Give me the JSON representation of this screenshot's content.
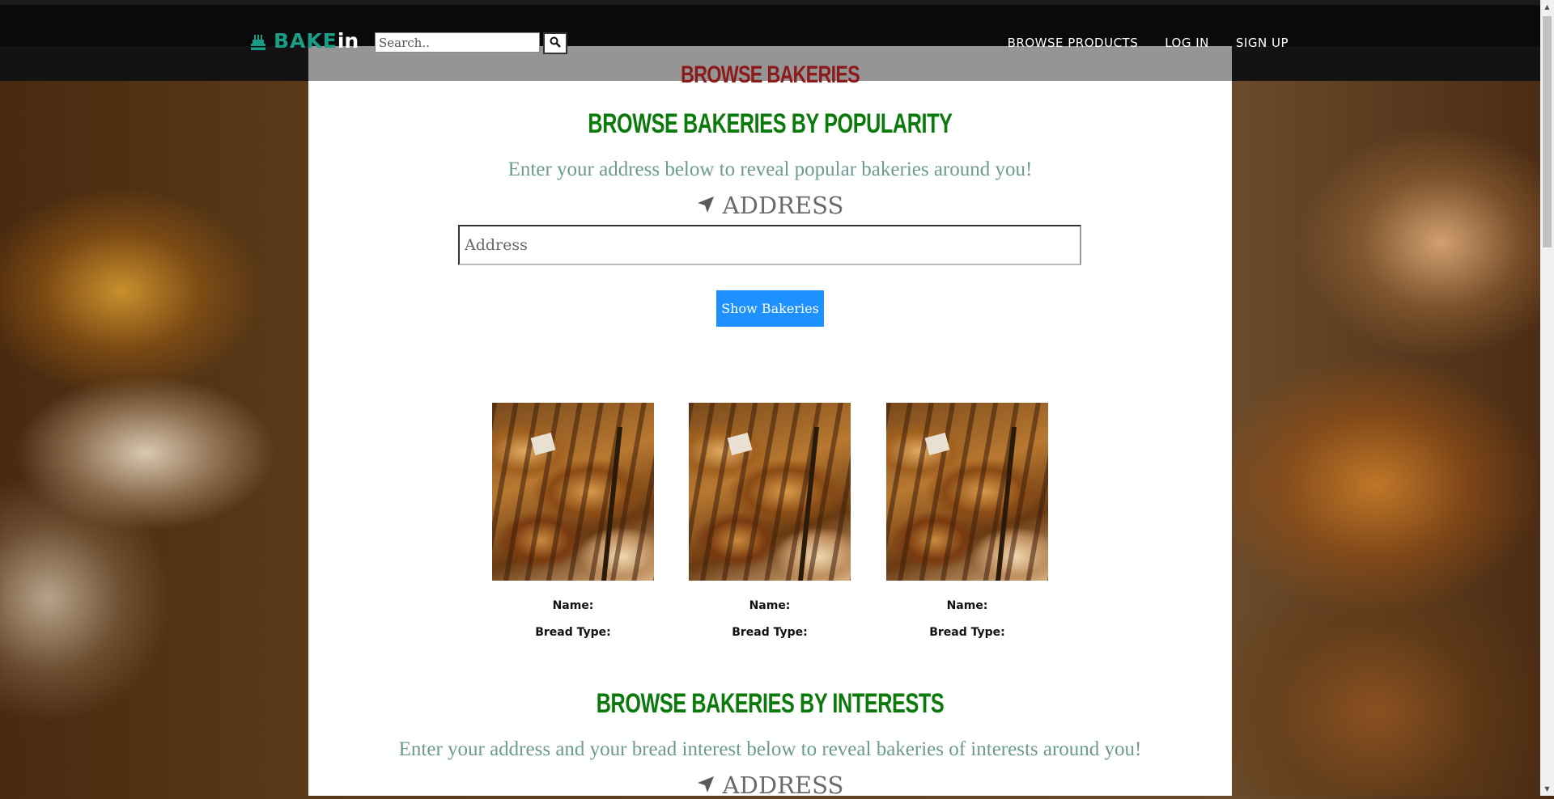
{
  "nav": {
    "logo_bake": "BAKE",
    "logo_in": "in",
    "search_placeholder": "Search..",
    "links": [
      "BROWSE PRODUCTS",
      "LOG IN",
      "SIGN UP"
    ]
  },
  "page": {
    "title": "BROWSE BAKERIES"
  },
  "popularity": {
    "heading": "BROWSE BAKERIES BY POPULARITY",
    "intro": "Enter your address below to reveal popular bakeries around you!",
    "address_label": "ADDRESS",
    "address_placeholder": "Address",
    "button_label": "Show Bakeries"
  },
  "cards": [
    {
      "name_label": "Name:",
      "bread_label": "Bread Type:"
    },
    {
      "name_label": "Name:",
      "bread_label": "Bread Type:"
    },
    {
      "name_label": "Name:",
      "bread_label": "Bread Type:"
    }
  ],
  "interests": {
    "heading": "BROWSE BAKERIES BY INTERESTS",
    "intro": "Enter your address and your bread interest below to reveal bakeries of interests around you!",
    "address_label": "ADDRESS"
  },
  "colors": {
    "brand_teal": "#1a9c86",
    "heading_green": "#0a7a0a",
    "title_red": "#8b1a1a",
    "button_blue": "#1e90ff",
    "intro_text": "#6b9a8f"
  },
  "icons": {
    "logo": "cake-icon",
    "search": "search-icon",
    "address": "location-arrow-icon"
  }
}
